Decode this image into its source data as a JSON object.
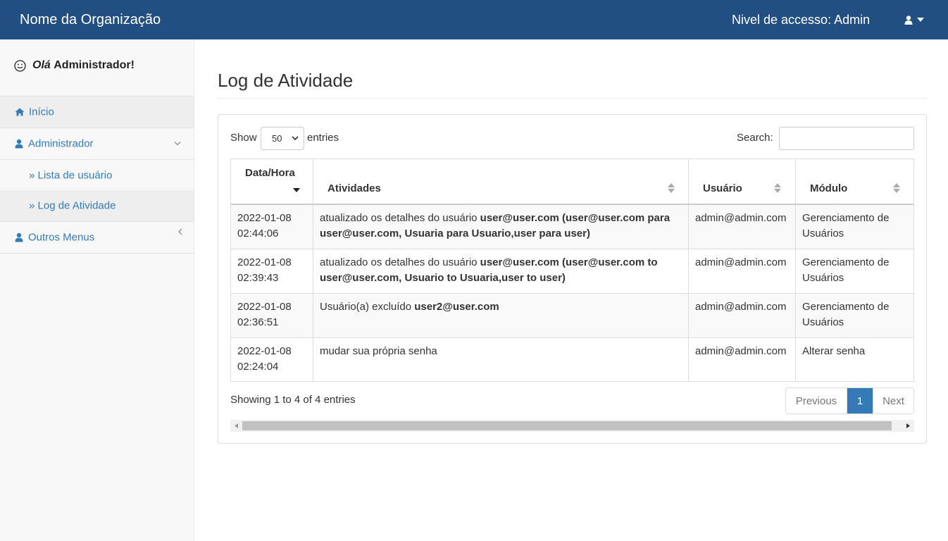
{
  "navbar": {
    "brand": "Nome da Organização",
    "access_level": "Nivel de accesso: Admin",
    "user_icon": "user-icon"
  },
  "sidebar": {
    "greeting_prefix": "Olá",
    "greeting_name": "Administrador!",
    "items": [
      {
        "label": "Início",
        "icon": "home-icon"
      },
      {
        "label": "Administrador",
        "icon": "user-icon"
      },
      {
        "label": "» Lista de usuário"
      },
      {
        "label": "» Log de Atividade"
      },
      {
        "label": "Outros Menus",
        "icon": "user-icon"
      }
    ]
  },
  "main": {
    "title": "Log de Atividade",
    "show_label": "Show",
    "page_length": "50",
    "entries_label": "entries",
    "search_label": "Search:",
    "search_value": "",
    "columns": [
      "Data/Hora",
      "Atividades",
      "Usuário",
      "Módulo"
    ],
    "rows": [
      {
        "date": "2022-01-08",
        "time": "02:44:06",
        "activity_text": "atualizado os detalhes do usuário ",
        "activity_bold_1": "user@user.com (user@user.com para",
        "activity_bold_2": "user@user.com, Usuaria para Usuario,user para user)",
        "user": "admin@admin.com",
        "module_1": "Gerenciamento de",
        "module_2": "Usuários"
      },
      {
        "date": "2022-01-08",
        "time": "02:39:43",
        "activity_text": "atualizado os detalhes do usuário ",
        "activity_bold_1": "user@user.com (user@user.com to",
        "activity_bold_2": "user@user.com, Usuario to Usuaria,user to user)",
        "user": "admin@admin.com",
        "module_1": "Gerenciamento de",
        "module_2": "Usuários"
      },
      {
        "date": "2022-01-08",
        "time": "02:36:51",
        "activity_text": "Usuário(a) excluído ",
        "activity_bold_1": "user2@user.com",
        "activity_bold_2": "",
        "user": "admin@admin.com",
        "module_1": "Gerenciamento de",
        "module_2": "Usuários"
      },
      {
        "date": "2022-01-08",
        "time": "02:24:04",
        "activity_text": "mudar sua própria senha",
        "activity_bold_1": "",
        "activity_bold_2": "",
        "user": "admin@admin.com",
        "module_1": "Alterar senha",
        "module_2": ""
      }
    ],
    "info": "Showing 1 to 4 of 4 entries",
    "pagination": {
      "previous": "Previous",
      "current": "1",
      "next": "Next"
    }
  },
  "colors": {
    "navbar": "#214f82",
    "link": "#337ab7",
    "active_page": "#337ab7"
  }
}
